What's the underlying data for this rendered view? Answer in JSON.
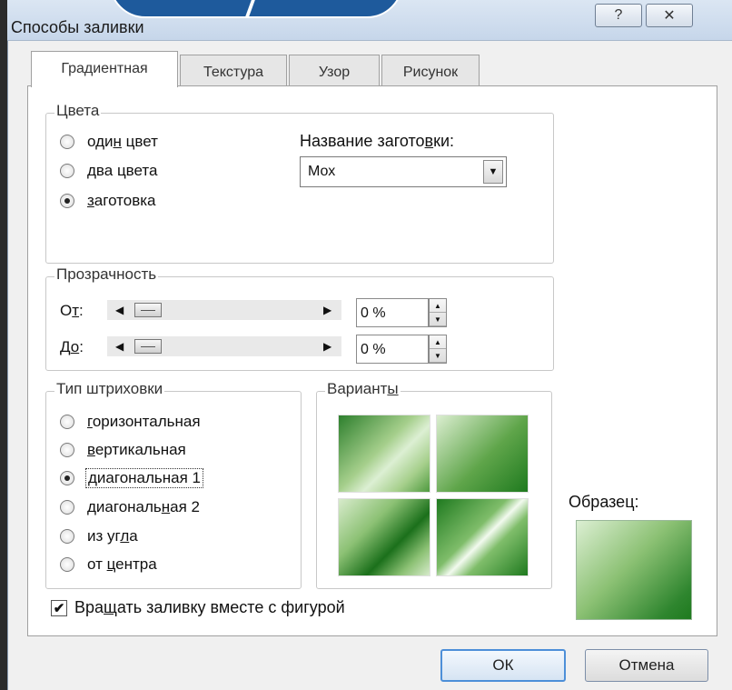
{
  "dialog": {
    "title": "Способы заливки",
    "help_glyph": "?",
    "close_glyph": "✕"
  },
  "tabs": [
    {
      "label": "Градиентная",
      "active": true
    },
    {
      "label": "Текстура",
      "active": false
    },
    {
      "label": "Узор",
      "active": false
    },
    {
      "label": "Рисунок",
      "active": false
    }
  ],
  "colors_group": {
    "label": "Цвета",
    "options": [
      {
        "pre": "оди",
        "ul": "н",
        "post": " цвет",
        "selected": false
      },
      {
        "pre": "",
        "ul": "д",
        "post": "ва цвета",
        "selected": false
      },
      {
        "pre": "",
        "ul": "з",
        "post": "аготовка",
        "selected": true
      }
    ],
    "preset_label_pre": "Название загото",
    "preset_label_ul": "в",
    "preset_label_post": "ки:",
    "preset_value": "Мох"
  },
  "transparency": {
    "label": "Прозрачность",
    "from_pre": "О",
    "from_ul": "т",
    "from_post": ":",
    "to_pre": "Д",
    "to_ul": "о",
    "to_post": ":",
    "from_value": "0 %",
    "to_value": "0 %",
    "from_percent": 0,
    "to_percent": 0
  },
  "shading": {
    "label": "Тип штриховки",
    "options": [
      {
        "pre": "",
        "ul": "г",
        "post": "оризонтальная",
        "selected": false
      },
      {
        "pre": "",
        "ul": "в",
        "post": "ертикальная",
        "selected": false
      },
      {
        "pre": "",
        "ul": "д",
        "post": "иагональная 1",
        "selected": true
      },
      {
        "pre": "диагональ",
        "ul": "н",
        "post": "ая 2",
        "selected": false
      },
      {
        "pre": "из уг",
        "ul": "л",
        "post": "а",
        "selected": false
      },
      {
        "pre": "от ",
        "ul": "ц",
        "post": "ентра",
        "selected": false
      }
    ]
  },
  "variants": {
    "label_pre": "Вариант",
    "label_ul": "ы"
  },
  "sample": {
    "label": "Образец:"
  },
  "rotate_checkbox": {
    "pre": "Вра",
    "ul": "щ",
    "post": "ать заливку вместе с фигурой",
    "checked": true,
    "check_glyph": "✔"
  },
  "buttons": {
    "ok": "ОК",
    "cancel": "Отмена"
  },
  "icons": {
    "left_arrow": "◀",
    "right_arrow": "▶",
    "down_arrow": "▼",
    "up_small": "▲",
    "down_small": "▼"
  },
  "palette": {
    "accent": "#4d8fd8",
    "light_green": "#dbeed0",
    "dark_green": "#1e7a1e"
  }
}
